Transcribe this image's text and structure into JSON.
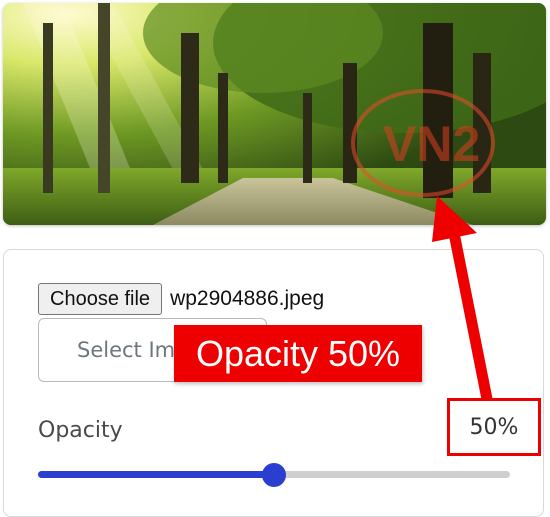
{
  "preview": {
    "image_name": "forest-road-image",
    "watermark": "VN2"
  },
  "file_input": {
    "button_label": "Choose file",
    "file_name": "wp2904886.jpeg"
  },
  "select_image": {
    "label": "Select Im"
  },
  "opacity": {
    "label": "Opacity",
    "value_text": "50%",
    "value": 0.5
  },
  "annotation": {
    "callout_text": "Opacity 50%",
    "color": "#ee0000"
  },
  "colors": {
    "accent": "#2a3fd0",
    "annotation_red": "#ee0000"
  }
}
